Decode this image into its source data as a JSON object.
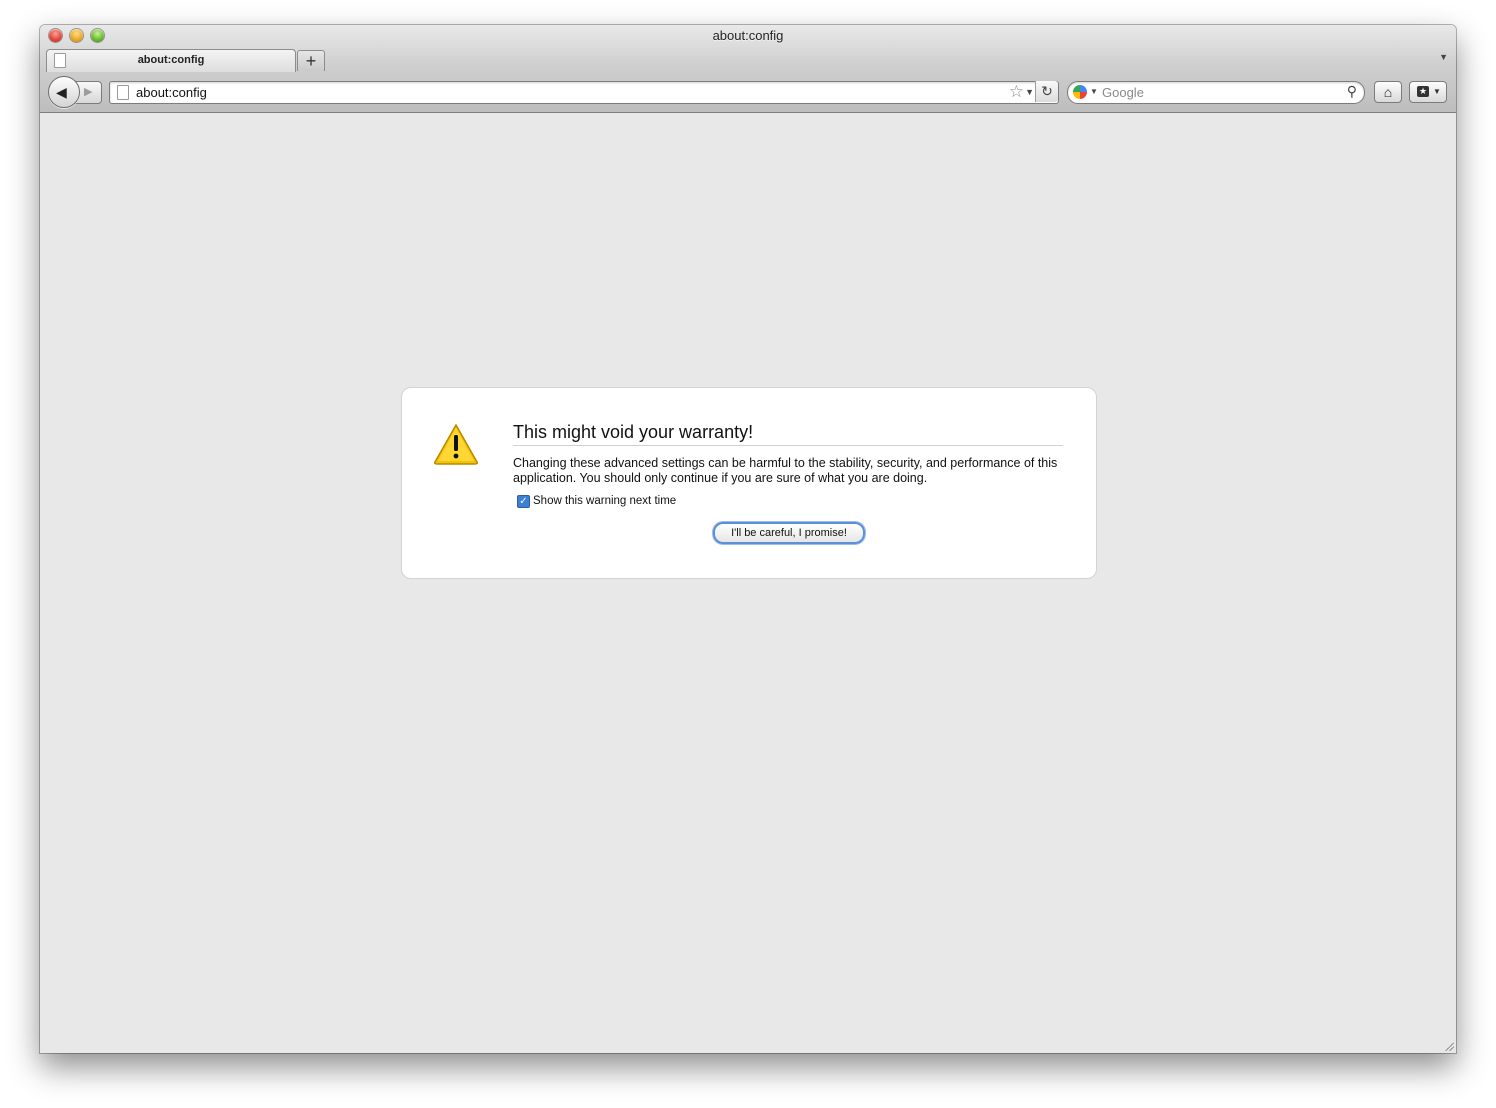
{
  "window": {
    "title": "about:config"
  },
  "tabs": [
    {
      "label": "about:config",
      "active": true
    }
  ],
  "toolbar": {
    "new_tab_label": "+",
    "url": "about:config",
    "search_placeholder": "Google",
    "search_engine_icon": "google-icon",
    "home_icon": "home-icon",
    "bookmarks_icon": "bookmarks-icon"
  },
  "warning": {
    "title": "This might void your warranty!",
    "text": "Changing these advanced settings can be harmful to the stability, security, and performance of this application. You should only continue if you are sure of what you are doing.",
    "checkbox_label": "Show this warning next time",
    "checkbox_checked": true,
    "button_label": "I'll be careful, I promise!",
    "icon": "warning-icon"
  },
  "colors": {
    "content_bg": "#e8e8e8",
    "box_bg": "#ffffff",
    "focus_ring": "#5b8fd6",
    "warning_yellow": "#f5c400"
  }
}
